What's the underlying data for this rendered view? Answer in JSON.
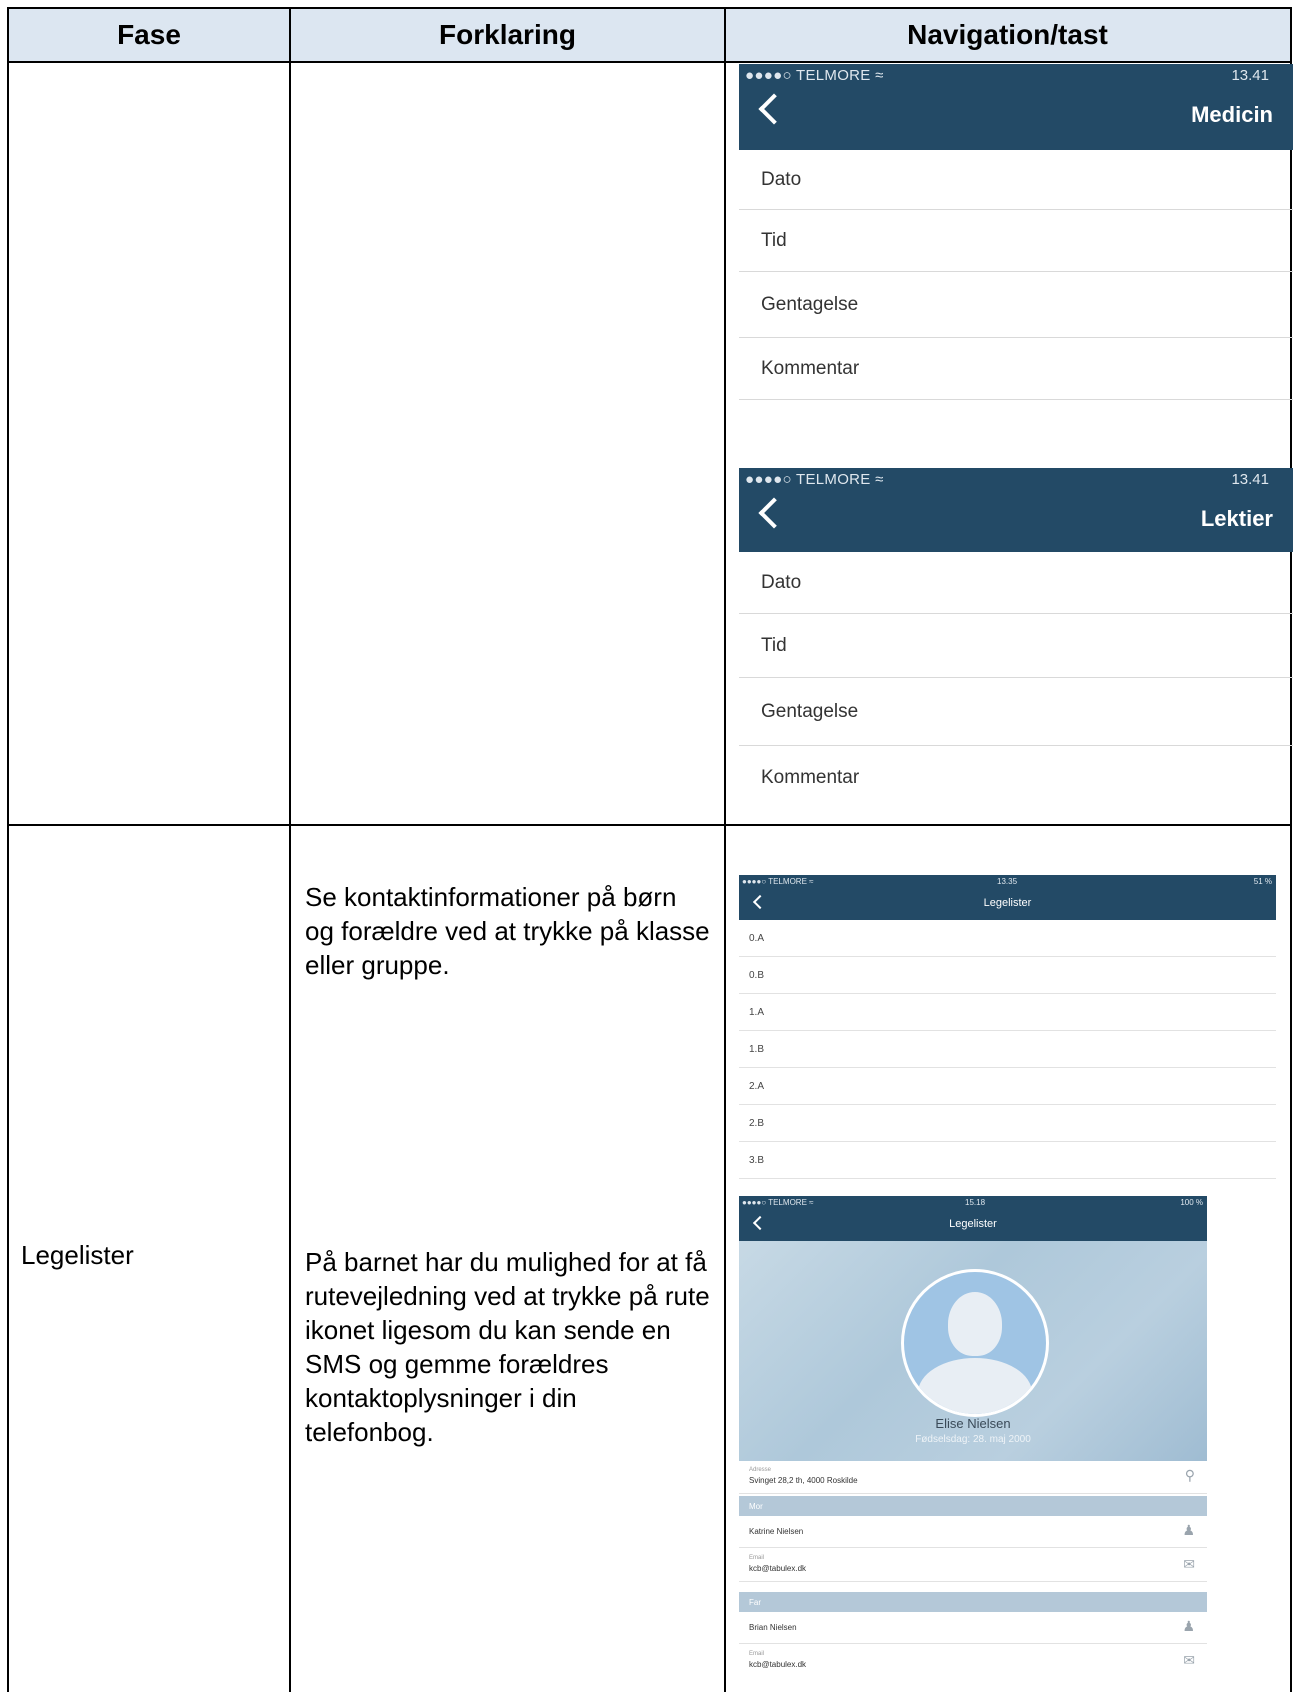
{
  "table": {
    "headers": [
      "Fase",
      "Forklaring",
      "Navigation/tast"
    ]
  },
  "row_top": {
    "screen_medicin": {
      "status": "●●●●○ TELMORE ≈",
      "time": "13.41",
      "title": "Medicin",
      "rows": [
        "Dato",
        "Tid",
        "Gentagelse",
        "Kommentar"
      ]
    },
    "screen_lektier": {
      "status": "●●●●○ TELMORE ≈",
      "time": "13.41",
      "title": "Lektier",
      "rows": [
        "Dato",
        "Tid",
        "Gentagelse",
        "Kommentar"
      ]
    }
  },
  "row_legelister": {
    "fase": "Legelister",
    "text1": "Se kontaktinformationer på børn og forældre ved at trykke på klasse eller gruppe.",
    "text2": "På barnet har du mulighed for at få rutevejledning ved at trykke på rute ikonet ligesom du kan sende en SMS og gemme forældres kontaktoplysninger i din telefonbog.",
    "screen_list": {
      "status": "●●●●○ TELMORE ≈",
      "time": "13.35",
      "battery": "51 %",
      "title": "Legelister",
      "rows": [
        "0.A",
        "0.B",
        "1.A",
        "1.B",
        "2.A",
        "2.B",
        "3.B"
      ]
    },
    "screen_child": {
      "status": "●●●●○ TELMORE ≈",
      "time": "15.18",
      "battery": "100 %",
      "title": "Legelister",
      "name": "Elise Nielsen",
      "birthday": "Fødselsdag: 28. maj 2000",
      "address_label": "Adresse",
      "address": "Svinget 28,2 th, 4000 Roskilde",
      "mother_section": "Mor",
      "mother_name": "Katrine Nielsen",
      "mother_email_label": "Email",
      "mother_email": "kcb@tabulex.dk",
      "father_section": "Far",
      "father_name": "Brian Nielsen",
      "father_email_label": "Email",
      "father_email": "kcb@tabulex.dk",
      "icons": [
        "location-pin-icon",
        "contact-icon",
        "mail-icon"
      ]
    }
  }
}
